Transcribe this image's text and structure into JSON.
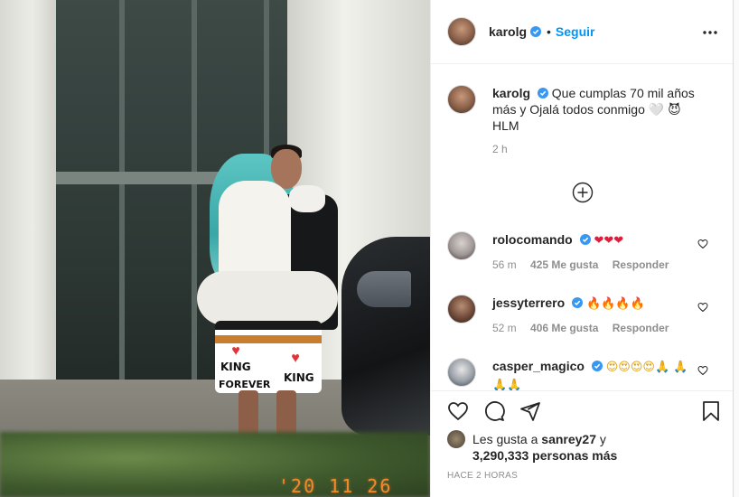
{
  "post": {
    "username": "karolg",
    "follow_label": "Seguir",
    "separator": "•",
    "caption": "Que cumplas 70 mil años más y Ojalá todos conmigo 🤍 😈 HLM",
    "caption_time": "2 h",
    "photo_date_stamp": "'20 11 26",
    "shorts_text_top": "KING",
    "shorts_text_bottom": "FOREVER",
    "shorts_text_right": "KING"
  },
  "comments": [
    {
      "username": "rolocomando",
      "text": "❤❤❤",
      "time": "56 m",
      "likes": "425 Me gusta",
      "reply": "Responder"
    },
    {
      "username": "jessyterrero",
      "text": "🔥🔥🔥🔥",
      "time": "52 m",
      "likes": "406 Me gusta",
      "reply": "Responder"
    },
    {
      "username": "casper_magico",
      "text": "😍😍😍😍🙏 🙏🙏🙏",
      "time": "",
      "likes": "",
      "reply": ""
    }
  ],
  "likes": {
    "prefix": "Les gusta a",
    "user": "sanrey27",
    "connector": "y",
    "others": "3,290,333 personas más"
  },
  "timestamp": "HACE 2 HORAS",
  "icons": {
    "more": "more-horizontal-icon",
    "verified": "verified-badge-icon",
    "load_more": "plus-circle-icon",
    "like": "heart-icon",
    "comment": "comment-icon",
    "share": "share-icon",
    "save": "bookmark-icon"
  },
  "colors": {
    "accent": "#0095f6",
    "text": "#262626",
    "secondary_text": "#8e8e8e",
    "date_stamp": "#f28a2c"
  }
}
